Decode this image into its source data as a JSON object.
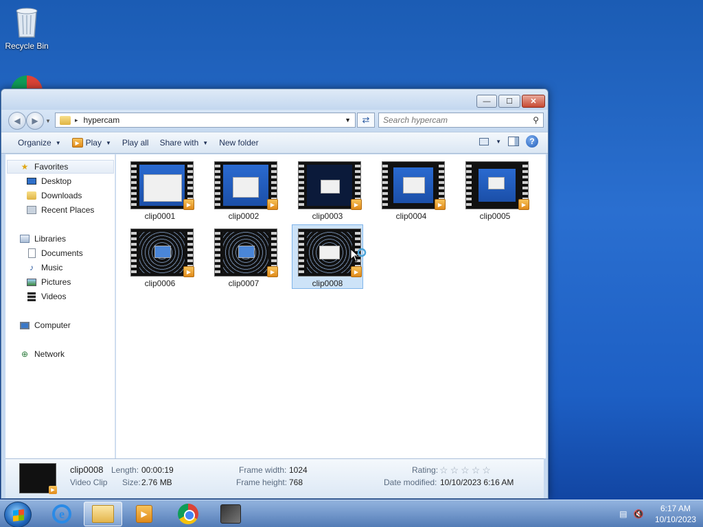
{
  "desktop": {
    "recycle_bin_label": "Recycle Bin"
  },
  "window": {
    "controls": {
      "minimize": "—",
      "maximize": "☐",
      "close": "✕"
    },
    "address": {
      "path": "hypercam",
      "separator": "▸"
    },
    "search": {
      "placeholder": "Search hypercam"
    },
    "toolbar": {
      "organize": "Organize",
      "play": "Play",
      "play_all": "Play all",
      "share_with": "Share with",
      "new_folder": "New folder"
    },
    "nav": {
      "favorites": "Favorites",
      "desktop": "Desktop",
      "downloads": "Downloads",
      "recent_places": "Recent Places",
      "libraries": "Libraries",
      "documents": "Documents",
      "music": "Music",
      "pictures": "Pictures",
      "videos": "Videos",
      "computer": "Computer",
      "network": "Network"
    },
    "files": [
      {
        "name": "clip0001"
      },
      {
        "name": "clip0002"
      },
      {
        "name": "clip0003"
      },
      {
        "name": "clip0004"
      },
      {
        "name": "clip0005"
      },
      {
        "name": "clip0006"
      },
      {
        "name": "clip0007"
      },
      {
        "name": "clip0008",
        "selected": true
      }
    ],
    "details": {
      "name": "clip0008",
      "type": "Video Clip",
      "length_label": "Length:",
      "length": "00:00:19",
      "size_label": "Size:",
      "size": "2.76 MB",
      "frame_width_label": "Frame width:",
      "frame_width": "1024",
      "frame_height_label": "Frame height:",
      "frame_height": "768",
      "rating_label": "Rating:",
      "rating": 0,
      "date_modified_label": "Date modified:",
      "date_modified": "10/10/2023 6:16 AM"
    }
  },
  "taskbar": {
    "apps": [
      "internet-explorer",
      "windows-explorer",
      "windows-media-player",
      "google-chrome",
      "hypercam"
    ],
    "active_app": "windows-explorer",
    "clock_time": "6:17 AM",
    "clock_date": "10/10/2023"
  },
  "colors": {
    "desktop_top": "#1b5cb4",
    "selection": "#cde3f8",
    "selection_border": "#7eb4ea",
    "close_button": "#c74a32"
  }
}
